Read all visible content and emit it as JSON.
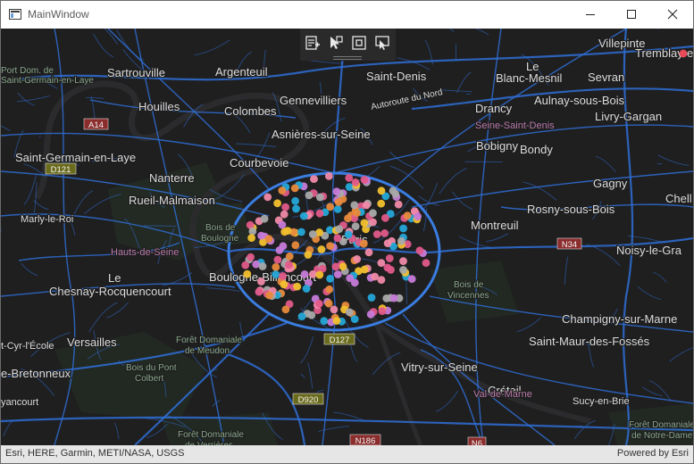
{
  "window": {
    "title": "MainWindow",
    "minimize_icon": "minimize-icon",
    "maximize_icon": "maximize-icon",
    "close_icon": "close-icon"
  },
  "toolbar": {
    "tools": [
      {
        "name": "edit-features-tool",
        "icon": "edit-form-icon"
      },
      {
        "name": "select-tool",
        "icon": "cursor-select-icon"
      },
      {
        "name": "rectangle-select-tool",
        "icon": "rectangle-select-icon"
      },
      {
        "name": "clear-selection-tool",
        "icon": "clear-selection-icon"
      }
    ]
  },
  "map": {
    "background_color": "#1d1d1e",
    "road_color": "#2f6fd6",
    "water_color": "#2a2a2c",
    "place_labels": [
      {
        "id": "villepinte",
        "text": "Villepinte"
      },
      {
        "id": "tremblay",
        "text": "Tremblay-e"
      },
      {
        "id": "port-dom",
        "text": "Port Dom. de"
      },
      {
        "id": "saint-germain-en-laye-park",
        "text": "Saint-Germain-en-Laye"
      },
      {
        "id": "sartrouville",
        "text": "Sartrouville"
      },
      {
        "id": "argenteuil",
        "text": "Argenteuil"
      },
      {
        "id": "saint-denis",
        "text": "Saint-Denis"
      },
      {
        "id": "le",
        "text": "Le"
      },
      {
        "id": "blanc-mesnil",
        "text": "Blanc-Mesnil"
      },
      {
        "id": "sevran",
        "text": "Sevran"
      },
      {
        "id": "houilles",
        "text": "Houilles"
      },
      {
        "id": "gennevilliers",
        "text": "Gennevilliers"
      },
      {
        "id": "autoroute-du-nord",
        "text": "Autoroute du Nord"
      },
      {
        "id": "aulnay",
        "text": "Aulnay-sous-Bois"
      },
      {
        "id": "colombes",
        "text": "Colombes"
      },
      {
        "id": "drancy",
        "text": "Drancy"
      },
      {
        "id": "livry",
        "text": "Livry-Gargan"
      },
      {
        "id": "asnieres",
        "text": "Asnières-sur-Seine"
      },
      {
        "id": "seine-saint-denis",
        "text": "Seine-Saint-Denis"
      },
      {
        "id": "a14",
        "text": "A14"
      },
      {
        "id": "bobigny",
        "text": "Bobigny"
      },
      {
        "id": "bondy",
        "text": "Bondy"
      },
      {
        "id": "saint-germain",
        "text": "Saint-Germain-en-Laye"
      },
      {
        "id": "courbevoie",
        "text": "Courbevoie"
      },
      {
        "id": "d121",
        "text": "D121"
      },
      {
        "id": "nanterre",
        "text": "Nanterre"
      },
      {
        "id": "gagny",
        "text": "Gagny"
      },
      {
        "id": "chell",
        "text": "Chell"
      },
      {
        "id": "rueil",
        "text": "Rueil-Malmaison"
      },
      {
        "id": "rosny",
        "text": "Rosny-sous-Bois"
      },
      {
        "id": "marly",
        "text": "Marly-le-Roi"
      },
      {
        "id": "bois-boulogne-1",
        "text": "Bois de"
      },
      {
        "id": "bois-boulogne-2",
        "text": "Boulogne"
      },
      {
        "id": "montreuil",
        "text": "Montreuil"
      },
      {
        "id": "paris",
        "text": "Paris"
      },
      {
        "id": "hauts-de-seine",
        "text": "Hauts-de-Seine"
      },
      {
        "id": "n34",
        "text": "N34"
      },
      {
        "id": "noisy",
        "text": "Noisy-le-Gra"
      },
      {
        "id": "le2",
        "text": "Le"
      },
      {
        "id": "boulogne-billancourt",
        "text": "Boulogne-Billancourt"
      },
      {
        "id": "chesnay",
        "text": "Chesnay-Rocquencourt"
      },
      {
        "id": "bois-vincennes-1",
        "text": "Bois de"
      },
      {
        "id": "bois-vincennes-2",
        "text": "Vincennes"
      },
      {
        "id": "champigny",
        "text": "Champigny-sur-Marne"
      },
      {
        "id": "saint-cyr",
        "text": "t-Cyr-l'École"
      },
      {
        "id": "versailles",
        "text": "Versailles"
      },
      {
        "id": "d127",
        "text": "D127"
      },
      {
        "id": "foret-meudon-1",
        "text": "Forêt Domaniale"
      },
      {
        "id": "foret-meudon-2",
        "text": "de Meudon"
      },
      {
        "id": "saint-maur",
        "text": "Saint-Maur-des-Fossés"
      },
      {
        "id": "bretonneux",
        "text": "e-Bretonneux"
      },
      {
        "id": "bois-pont-1",
        "text": "Bois du Pont"
      },
      {
        "id": "bois-pont-2",
        "text": "Colbert"
      },
      {
        "id": "vitry",
        "text": "Vitry-sur-Seine"
      },
      {
        "id": "creteil",
        "text": "Créteil"
      },
      {
        "id": "val-de-marne",
        "text": "Val-de-Marne"
      },
      {
        "id": "yancourt",
        "text": "yancourt"
      },
      {
        "id": "d920",
        "text": "D920"
      },
      {
        "id": "sucy",
        "text": "Sucy-en-Brie"
      },
      {
        "id": "foret-notre-dame-1",
        "text": "Forêt Domaniale"
      },
      {
        "id": "foret-notre-dame-2",
        "text": "de Notre-Dame"
      },
      {
        "id": "foret-verrieres-1",
        "text": "Forêt Domaniale"
      },
      {
        "id": "foret-verrieres-2",
        "text": "de Verrières"
      },
      {
        "id": "n186",
        "text": "N186"
      },
      {
        "id": "n6",
        "text": "N6"
      }
    ],
    "point_colors": [
      "#f2c02e",
      "#e05a8a",
      "#25a8d8",
      "#a9a9a9",
      "#e88a3c",
      "#c77bd8",
      "#f08aa8"
    ]
  },
  "attribution": {
    "left": "Esri, HERE, Garmin, METI/NASA, USGS",
    "right": "Powered by Esri"
  }
}
